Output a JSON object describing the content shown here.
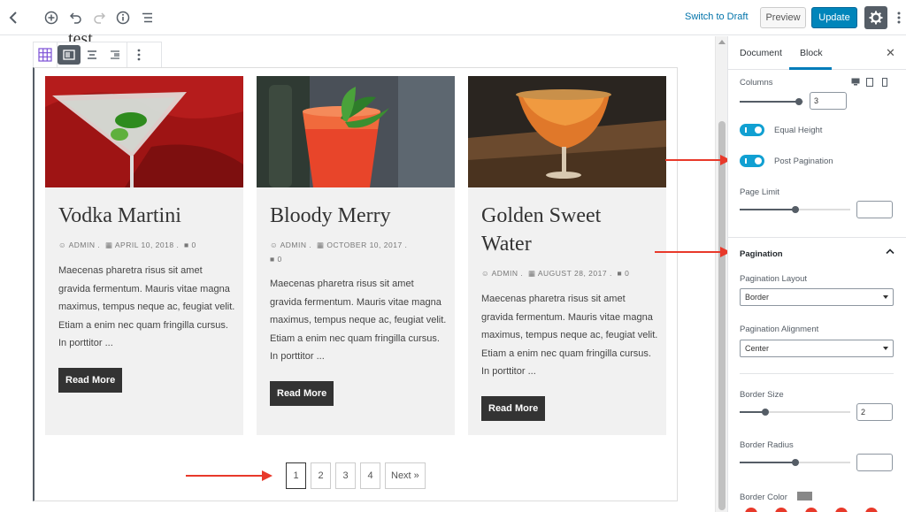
{
  "topbar": {
    "back_icon": "chevron-left-icon",
    "add_icon": "plus-circle-icon",
    "undo_icon": "undo-icon",
    "redo_icon": "redo-icon",
    "info_icon": "info-icon",
    "outline_icon": "list-icon",
    "switch_to_draft": "Switch to Draft",
    "preview": "Preview",
    "update": "Update",
    "accent": "#0085ba"
  },
  "editor": {
    "title_fragment": "test",
    "posts": [
      {
        "title": "Vodka Martini",
        "author": "ADMIN",
        "date": "APRIL 10, 2018",
        "comments": "0",
        "excerpt": "Maecenas pharetra risus sit amet gravida fermentum. Mauris vitae magna maximus, tempus neque ac, feugiat velit. Etiam a enim nec quam fringilla cursus. In porttitor ...",
        "read_more": "Read More"
      },
      {
        "title": "Bloody Merry",
        "author": "ADMIN",
        "date": "OCTOBER 10, 2017",
        "comments": "0",
        "excerpt": "Maecenas pharetra risus sit amet gravida fermentum. Mauris vitae magna maximus, tempus neque ac, feugiat velit. Etiam a enim nec quam fringilla cursus. In porttitor ...",
        "read_more": "Read More"
      },
      {
        "title": "Golden Sweet Water",
        "author": "ADMIN",
        "date": "AUGUST 28, 2017",
        "comments": "0",
        "excerpt": "Maecenas pharetra risus sit amet gravida fermentum. Mauris vitae magna maximus, tempus neque ac, feugiat velit. Etiam a enim nec quam fringilla cursus. In porttitor ...",
        "read_more": "Read More"
      }
    ],
    "pagination": [
      "1",
      "2",
      "3",
      "4",
      "Next »"
    ]
  },
  "sidebar": {
    "tabs": [
      "Document",
      "Block"
    ],
    "active_tab": "Block",
    "columns_label": "Columns",
    "columns_value": "3",
    "equal_height_label": "Equal Height",
    "post_pagination_label": "Post Pagination",
    "page_limit_label": "Page Limit",
    "page_limit_value": "",
    "pagination_section": "Pagination",
    "pagination_layout_label": "Pagination Layout",
    "pagination_layout_value": "Border",
    "pagination_alignment_label": "Pagination Alignment",
    "pagination_alignment_value": "Center",
    "border_size_label": "Border Size",
    "border_size_value": "2",
    "border_radius_label": "Border Radius",
    "border_radius_value": "",
    "border_color_label": "Border Color",
    "border_color": "#888888",
    "toggle_color": "#11a0d2"
  },
  "annotation_color": "#e8392a"
}
